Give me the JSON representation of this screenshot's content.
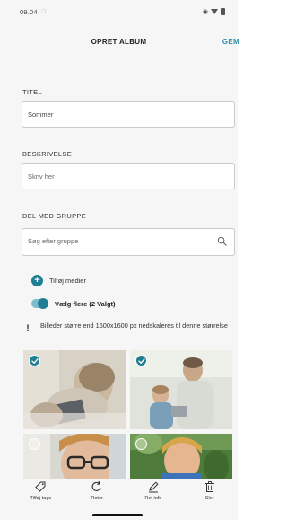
{
  "status_bar": {
    "time": "09.04",
    "notification_icon": "lock-small-icon",
    "right_icons": [
      "eye-icon",
      "signal-icon",
      "battery-icon"
    ]
  },
  "header": {
    "title": "OPRET ALBUM",
    "action": "GEM"
  },
  "form": {
    "title_label": "TITEL",
    "title_value": "Sommer",
    "description_label": "BESKRIVELSE",
    "description_placeholder": "Skriv her",
    "share_label": "DEL MED GRUPPE",
    "share_placeholder": "Søg efter gruppe"
  },
  "actions": {
    "add_media": "Tilføj medier",
    "select_multiple": "Vælg flere (2 Valgt)",
    "info_mark": "!",
    "info_text": "Billeder større end 1600x1600 px nedskaleres til denne størrelse"
  },
  "photos": [
    {
      "subject": "child-with-tablet",
      "selected": true
    },
    {
      "subject": "father-and-child",
      "selected": true
    },
    {
      "subject": "child-with-glasses",
      "selected": false
    },
    {
      "subject": "boy-outdoors",
      "selected": false
    }
  ],
  "toolbar": {
    "tag": "Tilføj tags",
    "rotate": "Roter",
    "edit": "Ret info",
    "delete": "Slet"
  },
  "colors": {
    "accent": "#1f7e93",
    "header_action": "#2e8fa8",
    "background": "#f6f6f6"
  }
}
